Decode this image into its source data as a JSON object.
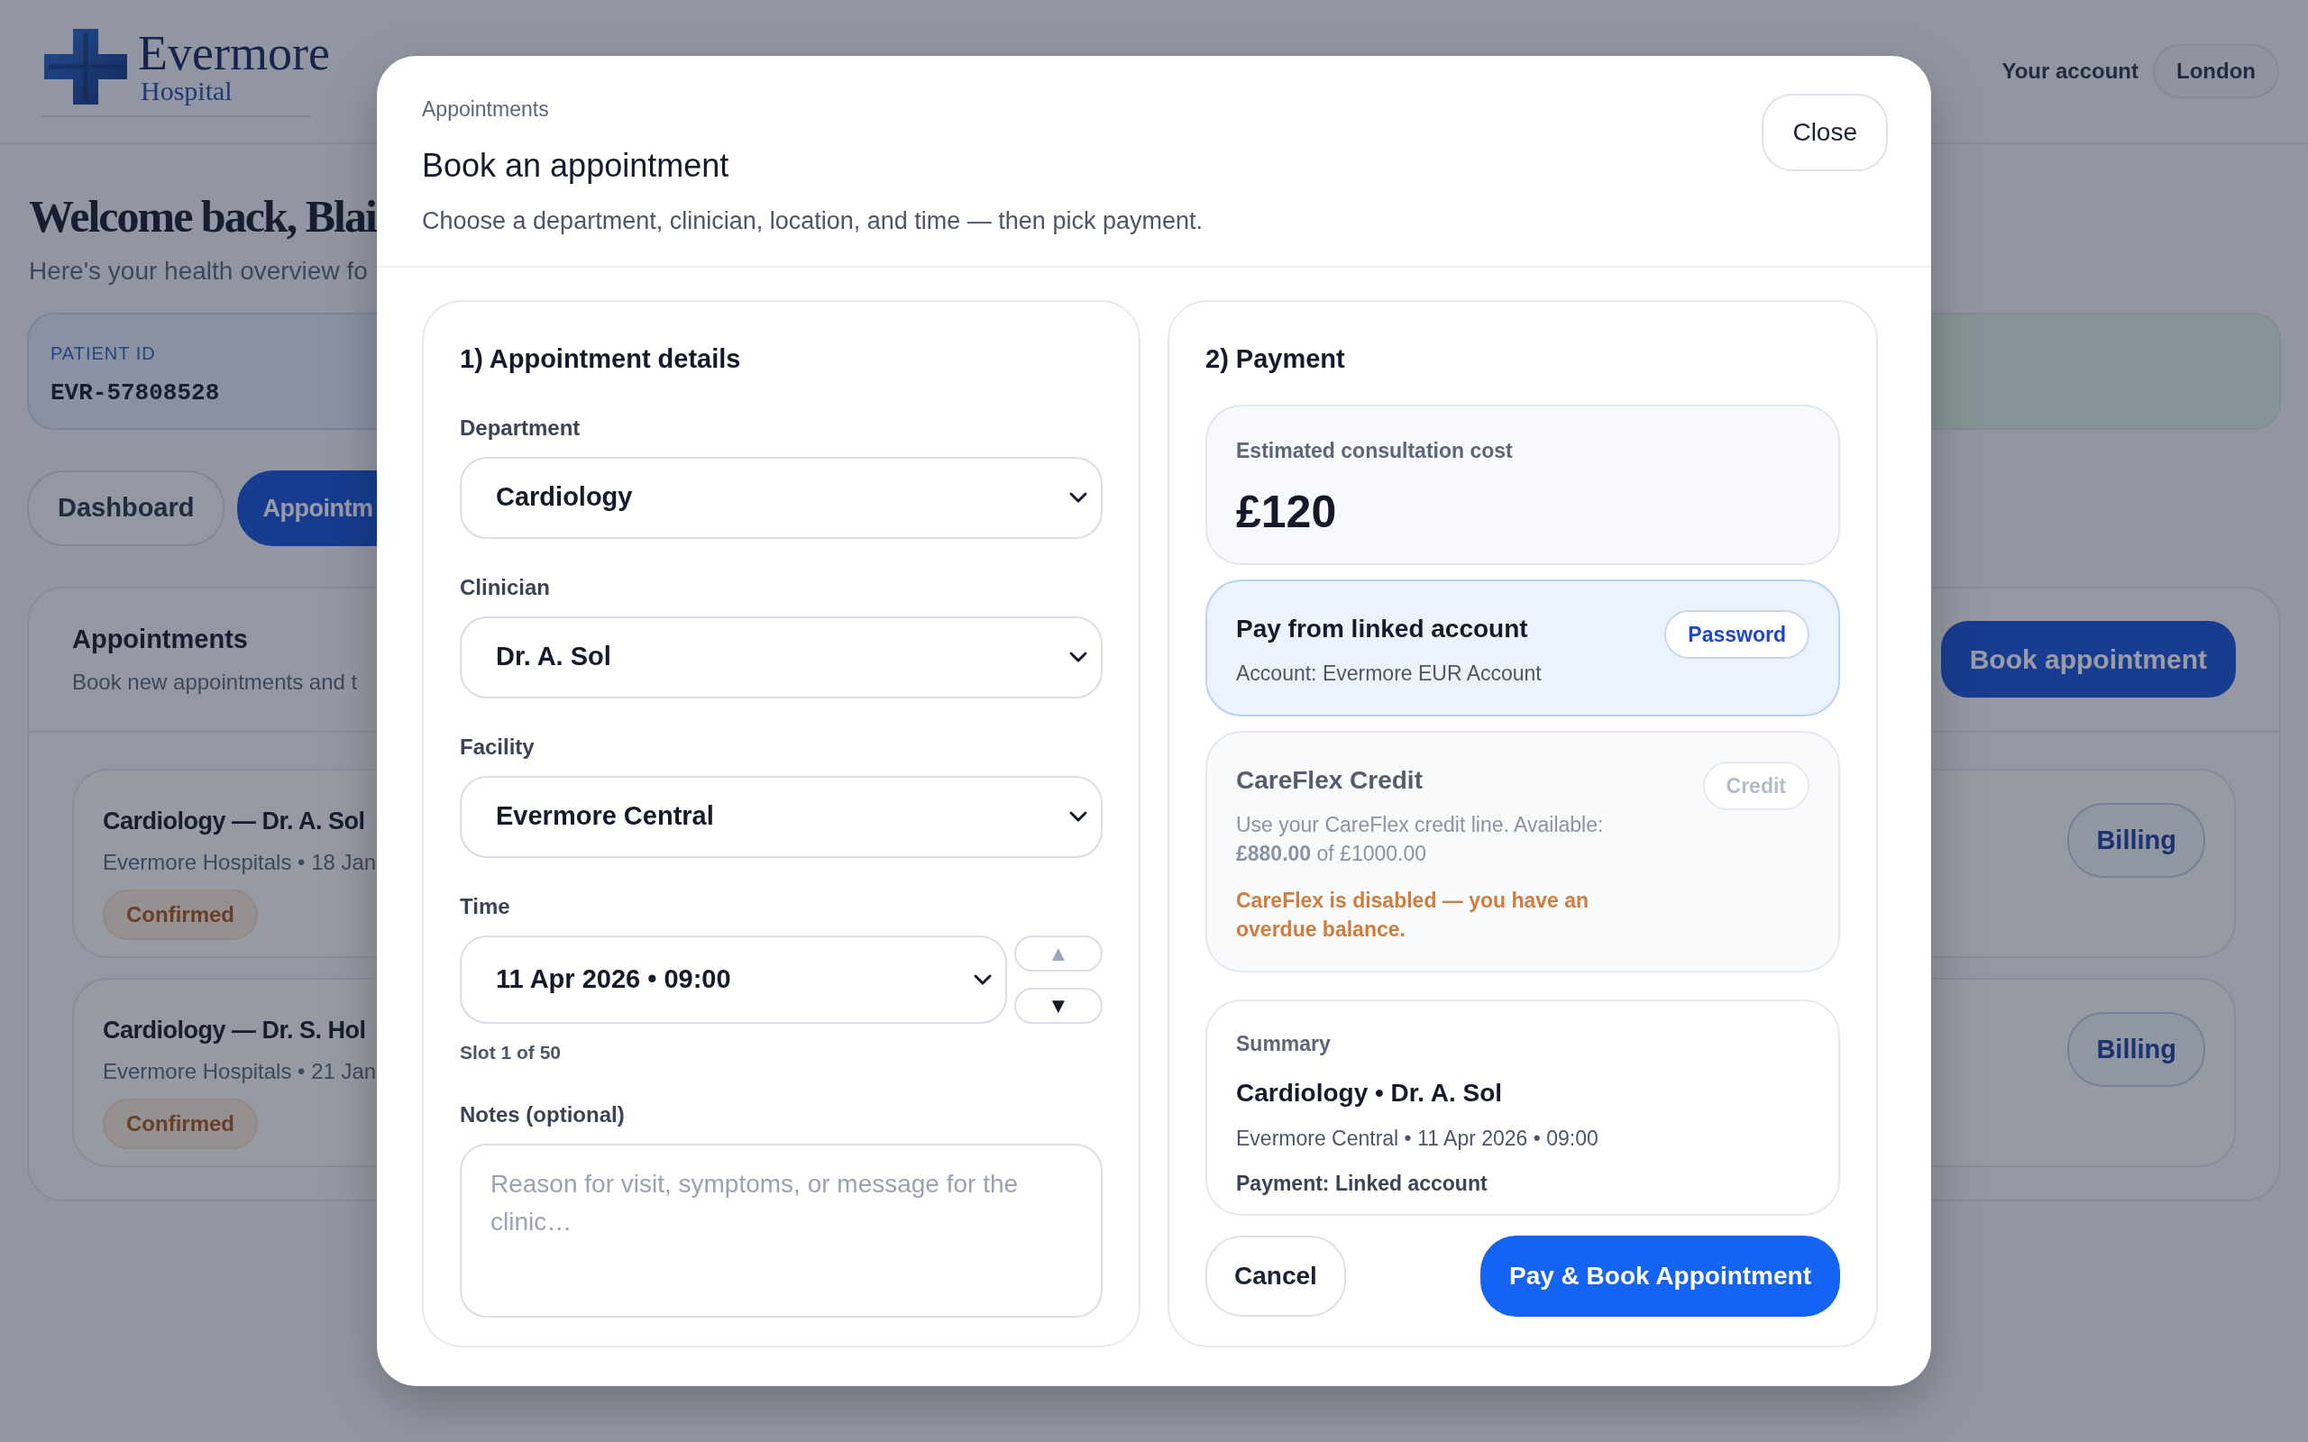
{
  "header": {
    "logo": {
      "name": "Evermore",
      "subtitle": "Hospital"
    },
    "account_label": "Your account",
    "location": "London"
  },
  "welcome": {
    "title": "Welcome back, Blai",
    "subtitle": "Here's your health overview fo"
  },
  "patient_card": {
    "label": "PATIENT ID",
    "value": "EVR-57808528"
  },
  "tabs": [
    {
      "label": "Dashboard",
      "selected": false
    },
    {
      "label": "Appointm",
      "selected": true
    }
  ],
  "appointments_panel": {
    "title": "Appointments",
    "subtitle": "Book new appointments and t",
    "book_button": "Book appointment",
    "items": [
      {
        "title": "Cardiology — Dr. A. Sol",
        "meta": "Evermore Hospitals • 18 Jan",
        "status": "Confirmed",
        "action": "Billing"
      },
      {
        "title": "Cardiology — Dr. S. Hol",
        "meta": "Evermore Hospitals • 21 Jan",
        "status": "Confirmed",
        "action": "Billing"
      }
    ]
  },
  "modal": {
    "eyebrow": "Appointments",
    "title": "Book an appointment",
    "subtitle": "Choose a department, clinician, location, and time — then pick payment.",
    "close": "Close",
    "details": {
      "title": "1) Appointment details",
      "fields": [
        {
          "label": "Department",
          "value": "Cardiology"
        },
        {
          "label": "Clinician",
          "value": "Dr. A. Sol"
        },
        {
          "label": "Facility",
          "value": "Evermore Central"
        }
      ],
      "time": {
        "label": "Time",
        "value": "11 Apr 2026 • 09:00",
        "up": {
          "glyph": "▲",
          "disabled": true
        },
        "down": {
          "glyph": "▼",
          "disabled": false
        },
        "hint": "Slot 1 of 50"
      },
      "notes": {
        "label": "Notes (optional)",
        "placeholder": "Reason for visit, symptoms, or message for the clinic…"
      }
    },
    "payment": {
      "title": "2) Payment",
      "cost": {
        "label": "Estimated consultation cost",
        "value": "£120"
      },
      "options": [
        {
          "title": "Pay from linked account",
          "description": "Account: Evermore EUR Account",
          "tag": "Password",
          "selected": true,
          "disabled": false
        },
        {
          "title": "CareFlex Credit",
          "description": "Use your CareFlex credit line. Available: **£880.00** of £1000.00",
          "tag": "Credit",
          "selected": false,
          "disabled": true,
          "warning": "CareFlex is disabled — you have an overdue balance."
        }
      ],
      "summary": {
        "label": "Summary",
        "title": "Cardiology • Dr. A. Sol",
        "detail": "Evermore Central • 11 Apr 2026 • 09:00",
        "payment": "Payment: Linked account"
      },
      "cancel": "Cancel",
      "submit": "Pay & Book Appointment"
    }
  }
}
